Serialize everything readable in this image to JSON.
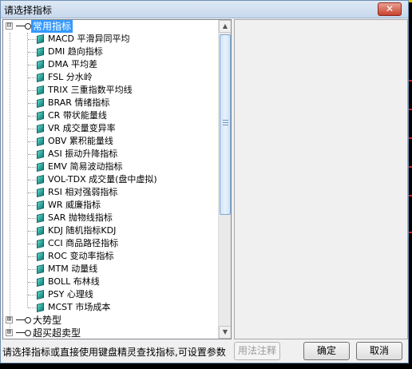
{
  "window": {
    "title": "请选择指标",
    "close_label": "✕"
  },
  "tree": {
    "groups": [
      {
        "label": "常用指标",
        "expanded": true,
        "expander": "⊟",
        "items": [
          "MACD 平滑异同平均",
          "DMI 趋向指标",
          "DMA 平均差",
          "FSL 分水岭",
          "TRIX 三重指数平均线",
          "BRAR 情绪指标",
          "CR 带状能量线",
          "VR 成交量变异率",
          "OBV 累积能量线",
          "ASI 振动升降指标",
          "EMV 简易波动指标",
          "VOL-TDX 成交量(盘中虚拟)",
          "RSI 相对强弱指标",
          "WR 威廉指标",
          "SAR 抛物线指标",
          "KDJ 随机指标KDJ",
          "CCI 商品路径指标",
          "ROC 变动率指标",
          "MTM 动量线",
          "BOLL 布林线",
          "PSY 心理线",
          "MCST 市场成本"
        ]
      },
      {
        "label": "大势型",
        "expanded": false,
        "expander": "⊞"
      },
      {
        "label": "超买超卖型",
        "expanded": false,
        "expander": "⊞"
      }
    ]
  },
  "scrollbar": {
    "up_arrow": "▲",
    "down_arrow": "▼"
  },
  "footer": {
    "hint": "请选择指标或直接使用键盘精灵查找指标,可设置参数",
    "usage_button": "用法注释",
    "ok_button": "确定",
    "cancel_button": "取消"
  },
  "colors": {
    "selection": "#3399ff",
    "leaf_icon": "#0c7f7a",
    "titlebar": "#c7d8ec",
    "close_button": "#c8412e"
  }
}
